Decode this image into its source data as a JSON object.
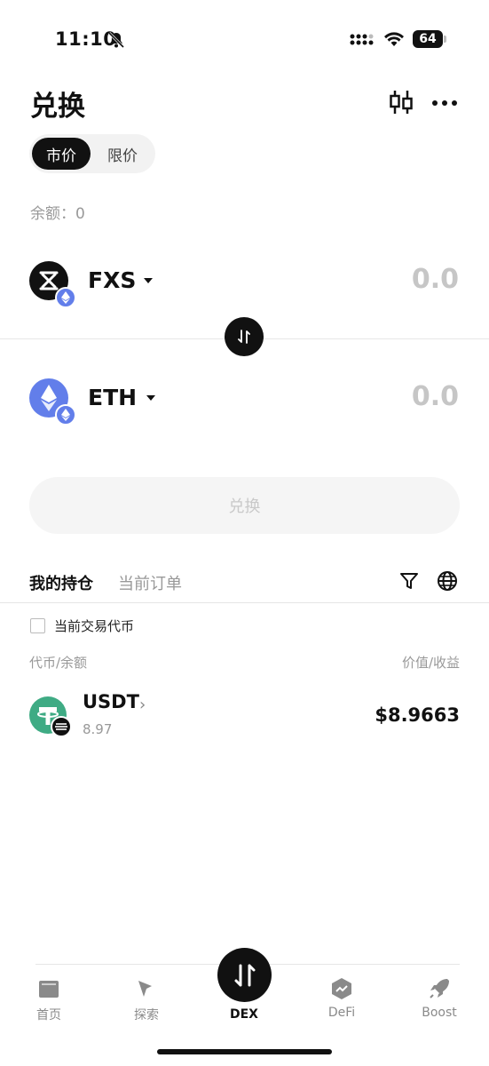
{
  "status_bar": {
    "time": "11:10",
    "battery": "64"
  },
  "header": {
    "title": "兑换"
  },
  "order_type": {
    "options": [
      "市价",
      "限价"
    ],
    "selected": "市价"
  },
  "balance": {
    "text": "余额：0"
  },
  "from_token": {
    "symbol": "FXS",
    "amount": "0.0",
    "icon": "fxs-logo",
    "chain_icon": "ethereum-icon"
  },
  "to_token": {
    "symbol": "ETH",
    "amount": "0.0",
    "icon": "eth-logo",
    "chain_icon": "ethereum-icon"
  },
  "swap_button": {
    "label": "兑换",
    "enabled": false
  },
  "holdings": {
    "tabs": [
      "我的持仓",
      "当前订单"
    ],
    "active_tab": "我的持仓",
    "filter_label": "当前交易代币",
    "columns": {
      "left": "代币/余额",
      "right": "价值/收益"
    },
    "items": [
      {
        "symbol": "USDT",
        "balance": "8.97",
        "value": "$8.9663",
        "icon": "usdt-logo",
        "chain_icon": "chain-icon"
      }
    ]
  },
  "bottom_nav": {
    "items": [
      {
        "label": "首页",
        "icon": "wallet-icon"
      },
      {
        "label": "探索",
        "icon": "compass-icon"
      },
      {
        "label": "DEX",
        "icon": "swap-icon",
        "active": true
      },
      {
        "label": "DeFi",
        "icon": "defi-icon"
      },
      {
        "label": "Boost",
        "icon": "rocket-icon"
      }
    ]
  },
  "colors": {
    "accent": "#111111",
    "eth": "#627eea",
    "usdt": "#3fab84",
    "muted": "#999999"
  }
}
